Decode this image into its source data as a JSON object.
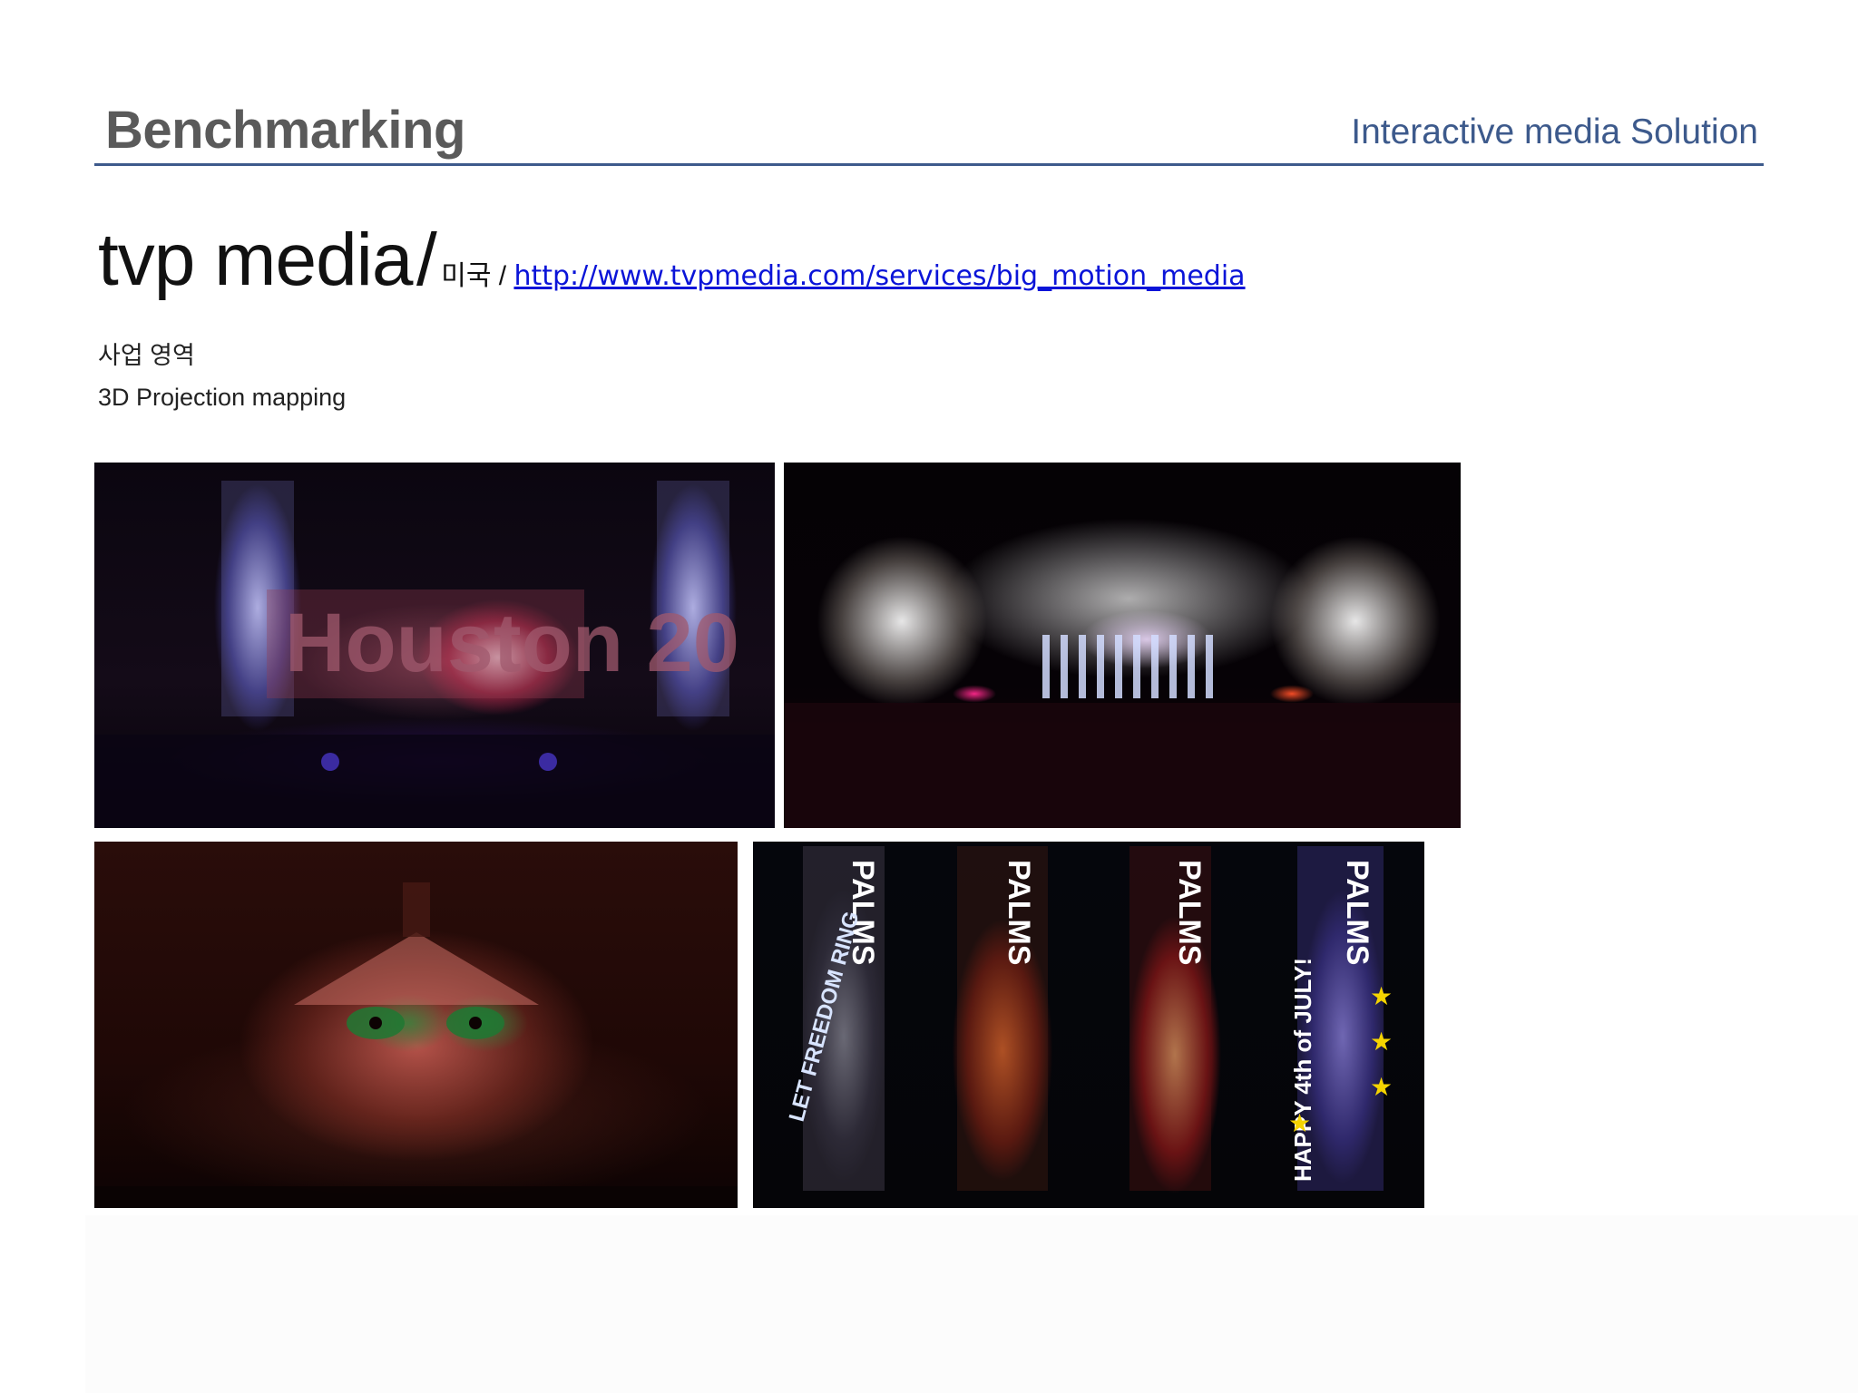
{
  "header": {
    "title": "Benchmarking",
    "subtitle": "Interactive media Solution"
  },
  "company": {
    "name": "tvp media",
    "separator": "/",
    "country": "미국",
    "meta_separator": " / ",
    "url": "http://www.tvpmedia.com/services/big_motion_media"
  },
  "business": {
    "label": "사업 영역",
    "value": "3D Projection mapping"
  },
  "photos": {
    "photo_1_text": "Houston 20",
    "photo_4_texts": [
      "PALMS",
      "PALMS",
      "PALMS",
      "PALMS",
      "LET FREEDOM RING",
      "HAPPY 4th of JULY!"
    ]
  }
}
